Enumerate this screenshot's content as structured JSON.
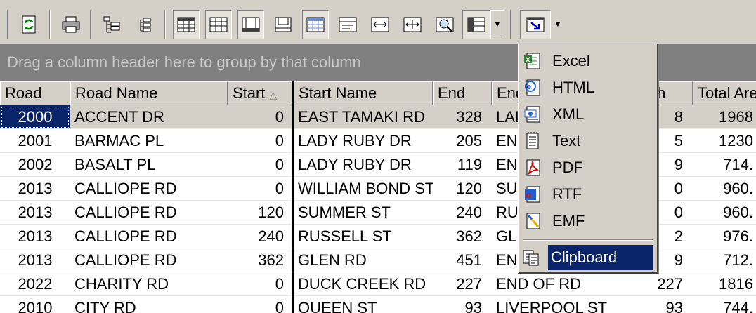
{
  "group_panel": {
    "text": "Drag a column header here to group by that column"
  },
  "columns": [
    "Road",
    "Road Name",
    "Start",
    "Start Name",
    "End",
    "End",
    "th",
    "Total Are"
  ],
  "rows": [
    {
      "road": "2000",
      "name": "ACCENT DR",
      "start": "0",
      "start_name": "EAST TAMAKI RD",
      "end": "328",
      "end_name": "LAD",
      "length": "8",
      "area": "1968"
    },
    {
      "road": "2001",
      "name": "BARMAC PL",
      "start": "0",
      "start_name": "LADY RUBY DR",
      "end": "205",
      "end_name": "EN",
      "length": "5",
      "area": "1230"
    },
    {
      "road": "2002",
      "name": "BASALT PL",
      "start": "0",
      "start_name": "LADY RUBY DR",
      "end": "119",
      "end_name": "EN",
      "length": "9",
      "area": "714."
    },
    {
      "road": "2013",
      "name": "CALLIOPE RD",
      "start": "0",
      "start_name": "WILLIAM BOND ST",
      "end": "120",
      "end_name": "SU",
      "length": "0",
      "area": "960."
    },
    {
      "road": "2013",
      "name": "CALLIOPE RD",
      "start": "120",
      "start_name": "SUMMER ST",
      "end": "240",
      "end_name": "RU",
      "length": "0",
      "area": "960."
    },
    {
      "road": "2013",
      "name": "CALLIOPE RD",
      "start": "240",
      "start_name": "RUSSELL ST",
      "end": "362",
      "end_name": "GL",
      "length": "2",
      "area": "976."
    },
    {
      "road": "2013",
      "name": "CALLIOPE RD",
      "start": "362",
      "start_name": "GLEN RD",
      "end": "451",
      "end_name": "EN",
      "length": "9",
      "area": "712."
    },
    {
      "road": "2022",
      "name": "CHARITY RD",
      "start": "0",
      "start_name": "DUCK CREEK RD",
      "end": "227",
      "end_name": "END OF RD",
      "length": "227",
      "area": "1816"
    },
    {
      "road": "2010",
      "name": "CITY RD",
      "start": "0",
      "start_name": "QUEEN ST",
      "end": "93",
      "end_name": "LIVERPOOL ST",
      "length": "93",
      "area": "744."
    }
  ],
  "export_menu": {
    "items": [
      {
        "label": "Excel",
        "icon": "excel-icon"
      },
      {
        "label": "HTML",
        "icon": "html-icon"
      },
      {
        "label": "XML",
        "icon": "xml-icon"
      },
      {
        "label": "Text",
        "icon": "text-file-icon"
      },
      {
        "label": "PDF",
        "icon": "pdf-icon"
      },
      {
        "label": "RTF",
        "icon": "rtf-icon"
      },
      {
        "label": "EMF",
        "icon": "emf-icon"
      }
    ],
    "highlighted": {
      "label": "Clipboard",
      "icon": "clipboard-icon"
    }
  },
  "colors": {
    "selection": "#0a246a",
    "toolbar": "#d4d0c8",
    "group_panel": "#808080"
  }
}
